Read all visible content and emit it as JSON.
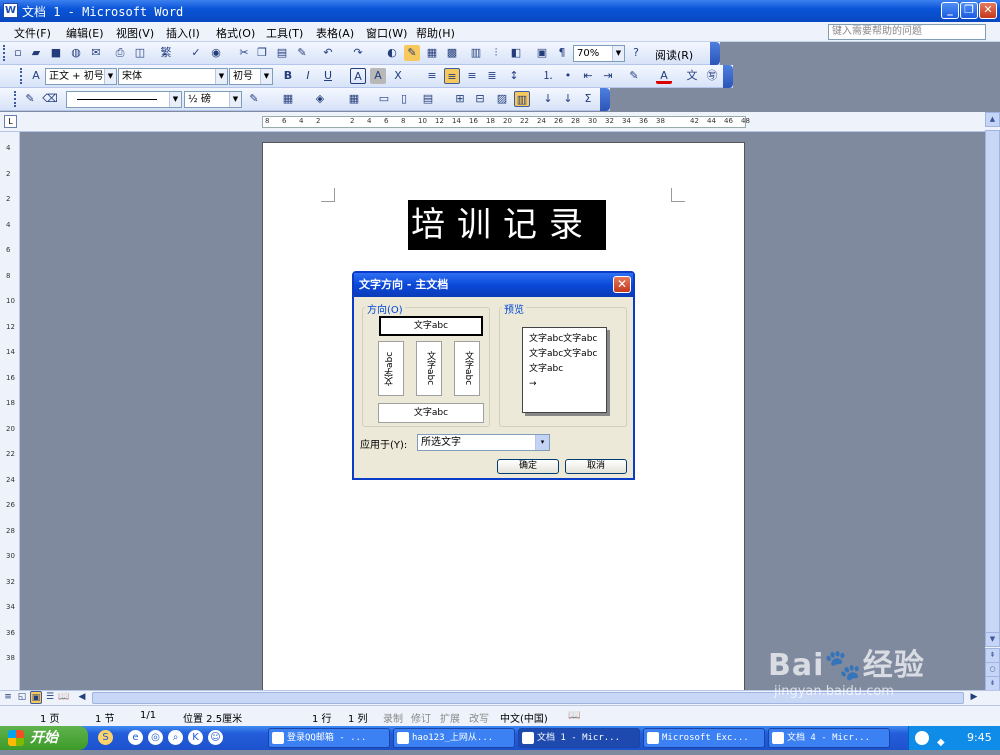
{
  "window": {
    "title": "文档 1 - Microsoft Word",
    "min": "_",
    "restore": "❐",
    "close": "✕"
  },
  "menu": {
    "items": [
      "文件(F)",
      "编辑(E)",
      "视图(V)",
      "插入(I)",
      "格式(O)",
      "工具(T)",
      "表格(A)",
      "窗口(W)",
      "帮助(H)"
    ],
    "help_placeholder": "键入需要帮助的问题"
  },
  "toolbar1": {
    "zoom": "70%",
    "read_label": "阅读(R)"
  },
  "toolbar2": {
    "style": "正文 + 初号",
    "font": "宋体",
    "size": "初号"
  },
  "toolbar3": {
    "line_width": "½ 磅"
  },
  "ruler": {
    "h_ticks": [
      "8",
      "6",
      "4",
      "2",
      "2",
      "4",
      "6",
      "8",
      "10",
      "12",
      "14",
      "16",
      "18",
      "20",
      "22",
      "24",
      "26",
      "28",
      "30",
      "32",
      "34",
      "36",
      "38",
      "42",
      "44",
      "46",
      "48"
    ],
    "v_ticks": [
      "4",
      "2",
      "2",
      "4",
      "6",
      "8",
      "10",
      "12",
      "14",
      "16",
      "18",
      "20",
      "22",
      "24",
      "26",
      "28",
      "30",
      "32",
      "34",
      "36",
      "38"
    ]
  },
  "document": {
    "title_text": "培训记录"
  },
  "dialog": {
    "title": "文字方向 - 主文档",
    "orientation_label": "方向(O)",
    "preview_label": "预览",
    "options": [
      "文字abc",
      "文字abc",
      "文字abc",
      "文字abc",
      "文字abc"
    ],
    "preview_text": "文字abc文字abc文字abc文字abc文字abc",
    "apply_label": "应用于(Y):",
    "apply_value": "所选文字",
    "ok": "确定",
    "cancel": "取消"
  },
  "status": {
    "page": "1 页",
    "section": "1 节",
    "pages": "1/1",
    "position": "位置 2.5厘米",
    "line": "1 行",
    "col": "1 列",
    "rec": "录制",
    "trk": "修订",
    "ext": "扩展",
    "ovr": "改写",
    "lang": "中文(中国)"
  },
  "taskbar": {
    "start": "开始",
    "items": [
      "登录QQ邮箱 - ...",
      "hao123_上网从...",
      "文档 1 - Micr...",
      "Microsoft Exc...",
      "文档 4 - Micr..."
    ],
    "time": "9:45"
  }
}
